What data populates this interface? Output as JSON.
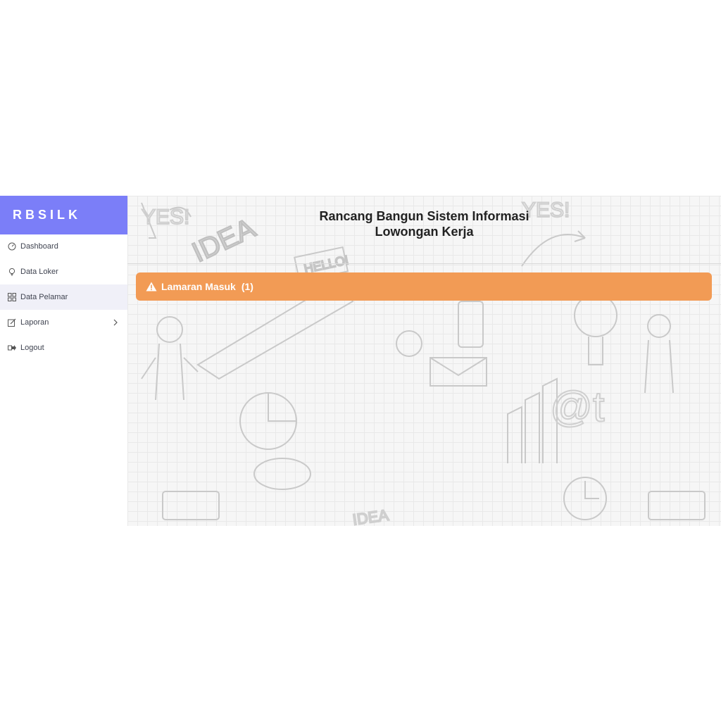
{
  "brand": {
    "name": "RBSILK",
    "color": "#7b7ef8"
  },
  "sidebar": {
    "items": [
      {
        "label": "Dashboard",
        "icon": "gauge-icon"
      },
      {
        "label": "Data Loker",
        "icon": "lightbulb-icon"
      },
      {
        "label": "Data Pelamar",
        "icon": "grid-icon",
        "active": true
      },
      {
        "label": "Laporan",
        "icon": "edit-icon",
        "has_submenu": true
      },
      {
        "label": "Logout",
        "icon": "logout-icon"
      }
    ]
  },
  "header": {
    "title_line1": "Rancang Bangun Sistem Informasi",
    "title_line2": "Lowongan Kerja"
  },
  "alert": {
    "label": "Lamaran Masuk",
    "count": "(1)",
    "icon": "warning-icon",
    "color": "#f29b55"
  }
}
